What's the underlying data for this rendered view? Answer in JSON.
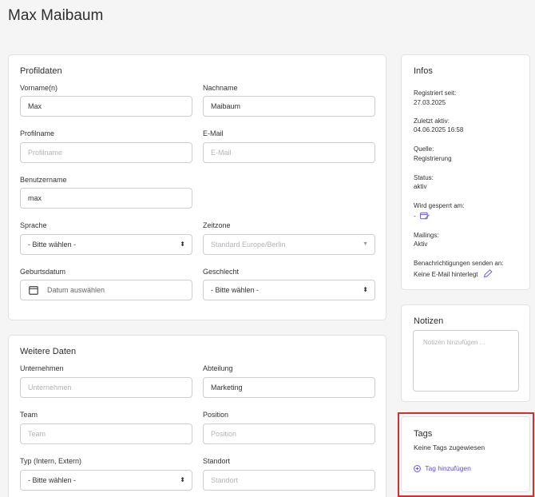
{
  "page_title": "Max Maibaum",
  "profile": {
    "title": "Profildaten",
    "vorname_label": "Vorname(n)",
    "vorname_value": "Max",
    "nachname_label": "Nachname",
    "nachname_value": "Maibaum",
    "profilname_label": "Profilname",
    "profilname_placeholder": "Profilname",
    "email_label": "E-Mail",
    "email_placeholder": "E-Mail",
    "benutzername_label": "Benutzername",
    "benutzername_value": "max",
    "sprache_label": "Sprache",
    "sprache_value": "- Bitte wählen -",
    "zeitzone_label": "Zeitzone",
    "zeitzone_value": "Standard Europe/Berlin",
    "geburtsdatum_label": "Geburtsdatum",
    "geburtsdatum_placeholder": "Datum auswählen",
    "geschlecht_label": "Geschlecht",
    "geschlecht_value": "- Bitte wählen -"
  },
  "weitere": {
    "title": "Weitere Daten",
    "unternehmen_label": "Unternehmen",
    "unternehmen_placeholder": "Unternehmen",
    "abteilung_label": "Abteilung",
    "abteilung_value": "Marketing",
    "team_label": "Team",
    "team_placeholder": "Team",
    "position_label": "Position",
    "position_placeholder": "Position",
    "typ_label": "Typ (Intern, Extern)",
    "typ_value": "- Bitte wählen -",
    "standort_label": "Standort",
    "standort_placeholder": "Standort"
  },
  "infos": {
    "title": "Infos",
    "registriert_label": "Registriert seit:",
    "registriert_value": "27.03.2025",
    "zuletzt_label": "Zuletzt aktiv:",
    "zuletzt_value": "04.06.2025 16:58",
    "quelle_label": "Quelle:",
    "quelle_value": "Registrierung",
    "status_label": "Status:",
    "status_value": "aktiv",
    "gesperrt_label": "Wird gesperrt am:",
    "gesperrt_value": "-",
    "mailings_label": "Mailings:",
    "mailings_value": "Aktiv",
    "benachrichtigungen_label": "Benachrichtigungen senden an:",
    "benachrichtigungen_value": "Keine E-Mail hinterlegt"
  },
  "notizen": {
    "title": "Notizen",
    "placeholder": "Notizen hinzufügen ..."
  },
  "tags": {
    "title": "Tags",
    "empty_text": "Keine Tags zugewiesen",
    "add_label": "Tag hinzufügen"
  },
  "colors": {
    "accent": "#5c4fd6",
    "highlight": "#d32f2f"
  },
  "icons": {
    "select_caret": "⬍",
    "dropdown_triangle": "▼",
    "calendar": "calendar-icon",
    "edit_calendar": "edit-calendar-icon",
    "pencil": "pencil-icon",
    "plus_circle": "plus-circle-icon"
  }
}
